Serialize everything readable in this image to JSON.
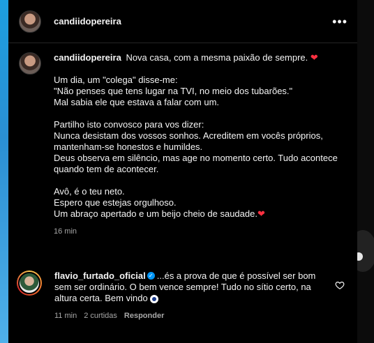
{
  "post": {
    "username": "candiidopereira",
    "more_label": "•••"
  },
  "caption": {
    "username": "candiidopereira",
    "text": "Nova casa, com a mesma paixão de sempre.",
    "heart": "❤",
    "paragraph_1": "Um dia, um \"colega\" disse-me:\n\"Não penses que tens lugar na TVI, no meio dos tubarões.\"\nMal sabia ele que estava a falar com um.",
    "paragraph_2": "Partilho isto convosco para vos dizer:\nNunca desistam dos vossos sonhos. Acreditem em vocês próprios, mantenham-se honestos e humildes.\nDeus observa em silêncio, mas age no momento certo. Tudo acontece quando tem de acontecer.",
    "paragraph_3": "Avô, é o teu neto.\nEspero que estejas orgulhoso.\nUm abraço apertado e um beijo cheio de saudade.",
    "heart_end": "❤",
    "time": "16 min"
  },
  "comment": {
    "username": "flavio_furtado_oficial",
    "text": "...és a prova de que é possível ser bom sem ser ordinário. O bem vence sempre! Tudo no sítio certo, na altura certa. Bem vindo",
    "time": "11 min",
    "likes": "2 curtidas",
    "reply": "Responder"
  },
  "colors": {
    "accent_heart": "#ff3040",
    "verified": "#0095f6",
    "left_strip": "#1d9fe0"
  },
  "icons": [
    "more-icon",
    "heart-icon",
    "verified-icon",
    "eye-icon",
    "heart-outline-icon"
  ]
}
